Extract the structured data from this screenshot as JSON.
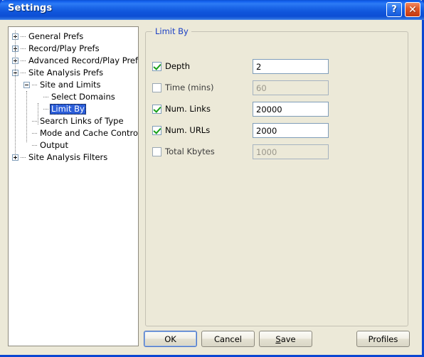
{
  "window": {
    "title": "Settings",
    "help_button": "?",
    "close_button": "✕"
  },
  "tree": {
    "items": [
      {
        "label": "General Prefs",
        "level": 0,
        "expander": "plus",
        "selected": false
      },
      {
        "label": "Record/Play Prefs",
        "level": 0,
        "expander": "plus",
        "selected": false
      },
      {
        "label": "Advanced Record/Play Prefs",
        "level": 0,
        "expander": "plus",
        "selected": false
      },
      {
        "label": "Site Analysis Prefs",
        "level": 0,
        "expander": "minus",
        "selected": false
      },
      {
        "label": "Site and Limits",
        "level": 1,
        "expander": "minus",
        "selected": false
      },
      {
        "label": "Select Domains",
        "level": 2,
        "expander": "none",
        "selected": false
      },
      {
        "label": "Limit By",
        "level": 2,
        "expander": "none",
        "selected": true
      },
      {
        "label": "Search Links of Type",
        "level": 1,
        "expander": "none",
        "selected": false
      },
      {
        "label": "Mode and Cache Control",
        "level": 1,
        "expander": "none",
        "selected": false
      },
      {
        "label": "Output",
        "level": 1,
        "expander": "none",
        "selected": false
      },
      {
        "label": "Site Analysis Filters",
        "level": 0,
        "expander": "plus",
        "selected": false
      }
    ]
  },
  "groupbox": {
    "label": "Limit By",
    "rows": [
      {
        "label": "Depth",
        "checked": true,
        "enabled": true,
        "value": "2"
      },
      {
        "label": "Time (mins)",
        "checked": false,
        "enabled": false,
        "value": "60"
      },
      {
        "label": "Num. Links",
        "checked": true,
        "enabled": true,
        "value": "20000"
      },
      {
        "label": "Num. URLs",
        "checked": true,
        "enabled": true,
        "value": "2000"
      },
      {
        "label": "Total Kbytes",
        "checked": false,
        "enabled": false,
        "value": "1000"
      }
    ]
  },
  "buttons": {
    "ok": "OK",
    "cancel": "Cancel",
    "save_prefix": "",
    "save_accel": "S",
    "save_suffix": "ave",
    "profiles": "Profiles"
  },
  "colors": {
    "titlebar_blue": "#0b51d6",
    "window_border": "#0a46d2",
    "dialog_face": "#ece9d8",
    "selection_blue": "#2c5ed9",
    "group_label_blue": "#1a3fc4",
    "check_green": "#17a017",
    "close_red": "#c5370f"
  }
}
